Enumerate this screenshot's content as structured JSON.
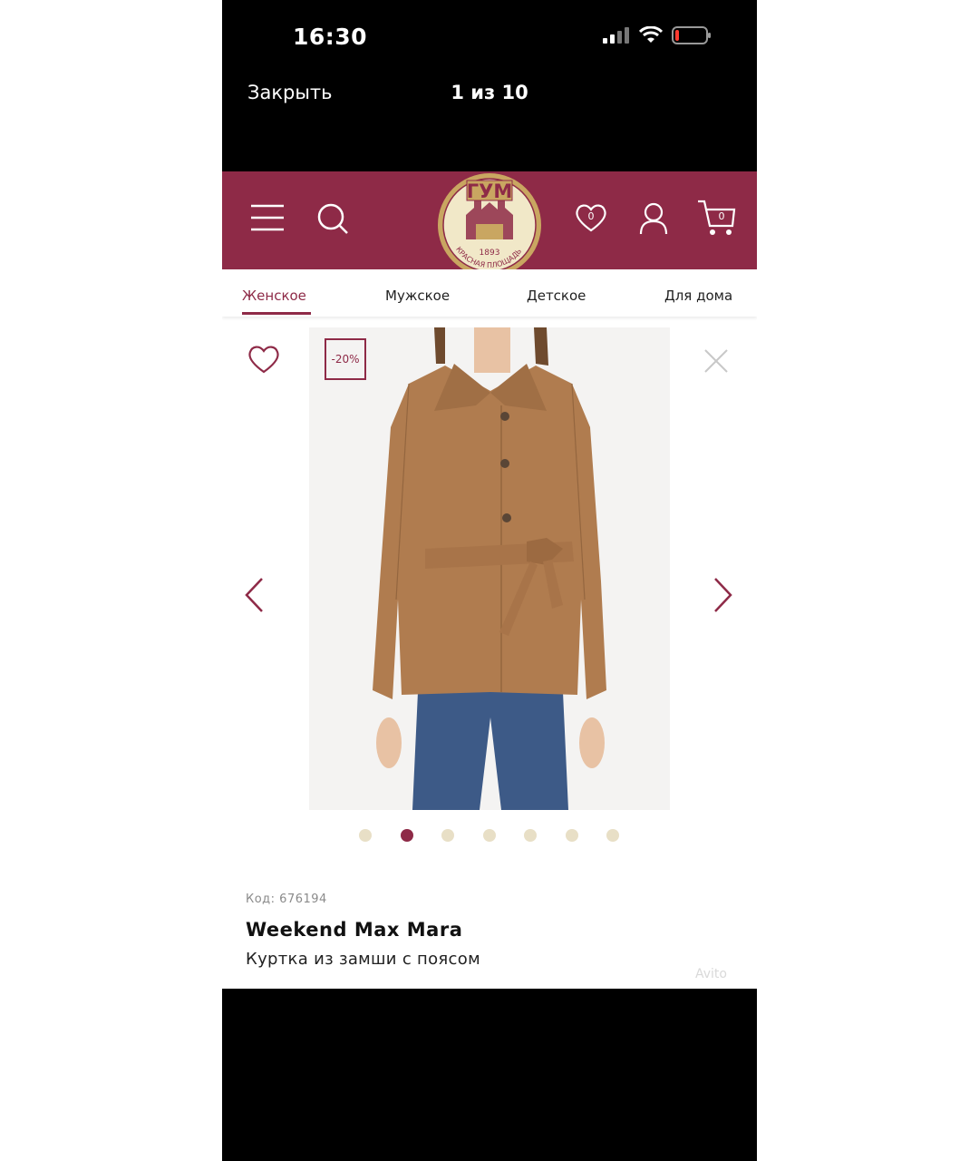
{
  "status_bar": {
    "time": "16:30"
  },
  "viewer": {
    "close_label": "Закрыть",
    "counter": "1 из 10"
  },
  "header": {
    "logo_text": "ГУМ",
    "logo_year": "1893",
    "logo_subtext": "КРАСНАЯ ПЛОЩАДЬ",
    "favorites_count": "0",
    "cart_count": "0"
  },
  "tabs": [
    {
      "label": "Женское"
    },
    {
      "label": "Мужское"
    },
    {
      "label": "Детское"
    },
    {
      "label": "Для дома"
    }
  ],
  "product": {
    "discount_badge": "-20%",
    "code": "Код: 676194",
    "brand": "Weekend Max Mara",
    "description": "Куртка из замши с поясом",
    "gallery_dots": 7,
    "active_dot": 2
  },
  "watermark": "Avito",
  "colors": {
    "brand": "#8e2a47",
    "dot_inactive": "#e8dfc6"
  }
}
